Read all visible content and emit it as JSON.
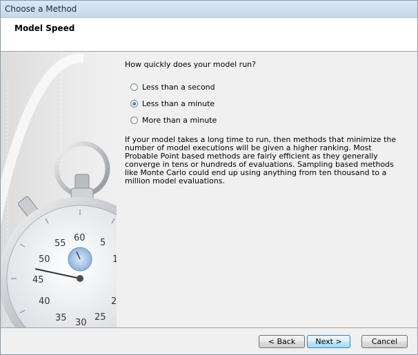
{
  "window": {
    "title": "Choose a Method"
  },
  "header": {
    "heading": "Model Speed"
  },
  "main": {
    "question": "How quickly does your model run?",
    "options": [
      {
        "label": "Less than a second",
        "selected": false
      },
      {
        "label": "Less than a minute",
        "selected": true
      },
      {
        "label": "More than a minute",
        "selected": false
      }
    ],
    "description": "If your model takes a long time to run, then methods that minimize the number of model executions will be given a higher ranking. Most Probable Point based methods are fairly efficient as they generally converge in tens or hundreds of evaluations. Sampling based methods like Monte Carlo could end up using anything from ten thousand to a million model evaluations."
  },
  "stopwatch": {
    "numbers": [
      "55",
      "60",
      "5",
      "50",
      "1",
      "45",
      "40",
      "2",
      "35",
      "30",
      "25"
    ]
  },
  "footer": {
    "back_label": "< Back",
    "next_label": "Next >",
    "cancel_label": "Cancel"
  }
}
